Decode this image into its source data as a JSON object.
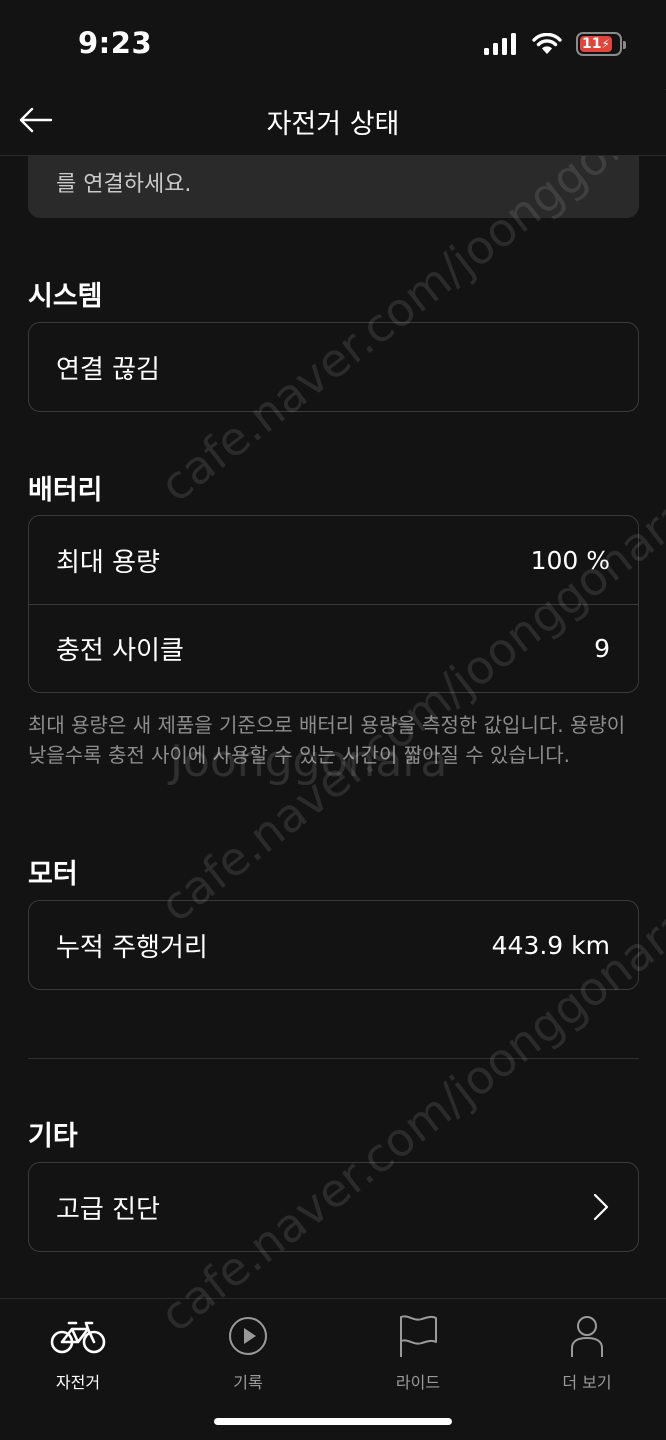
{
  "status_bar": {
    "time": "9:23",
    "battery_level": "11"
  },
  "header": {
    "title": "자전거 상태"
  },
  "notice": {
    "text": "를 연결하세요."
  },
  "sections": {
    "system": {
      "title": "시스템",
      "status": "연결 끊김"
    },
    "battery": {
      "title": "배터리",
      "rows": [
        {
          "label": "최대 용량",
          "value": "100 %"
        },
        {
          "label": "충전 사이클",
          "value": "9"
        }
      ],
      "helper": "최대 용량은 새 제품을 기준으로 배터리 용량을 측정한 값입니다. 용량이 낮을수록 충전 사이에 사용할 수 있는 시간이 짧아질 수 있습니다."
    },
    "motor": {
      "title": "모터",
      "rows": [
        {
          "label": "누적 주행거리",
          "value": "443.9 km"
        }
      ]
    },
    "other": {
      "title": "기타",
      "advanced_label": "고급 진단"
    }
  },
  "tab_bar": {
    "items": [
      {
        "label": "자전거",
        "icon": "bicycle-icon",
        "active": true
      },
      {
        "label": "기록",
        "icon": "play-circle-icon",
        "active": false
      },
      {
        "label": "라이드",
        "icon": "flag-icon",
        "active": false
      },
      {
        "label": "더 보기",
        "icon": "person-icon",
        "active": false
      }
    ]
  },
  "watermark": {
    "cafe": "cafe.naver.com/joonggonara",
    "brand": "Joonggonara"
  },
  "colors": {
    "background": "#131313",
    "card_border": "#3a3a3a",
    "battery_low": "#e0443a",
    "muted_text": "#8c8c8c"
  }
}
